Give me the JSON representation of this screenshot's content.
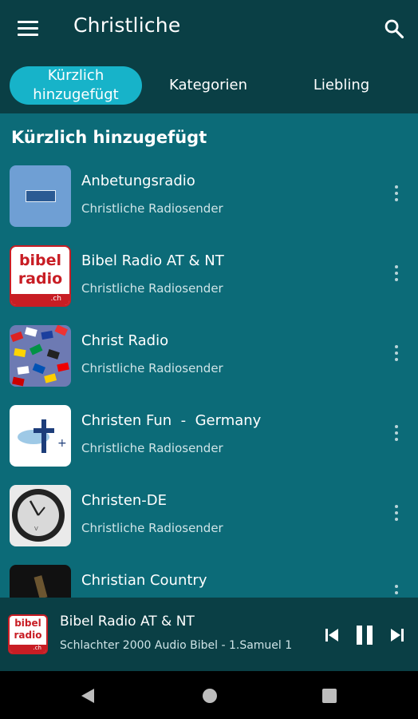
{
  "appbar": {
    "title": "Christliche",
    "menu_icon": "menu-icon",
    "search_icon": "search-icon"
  },
  "tabs": [
    {
      "label_line1": "Kürzlich",
      "label_line2": "hinzugefügt",
      "active": true
    },
    {
      "label": "Kategorien",
      "active": false
    },
    {
      "label": "Liebling",
      "active": false
    }
  ],
  "section_title": "Kürzlich hinzugefügt",
  "stations": [
    {
      "name": "Anbetungsradio",
      "category": "Christliche Radiosender"
    },
    {
      "name": "Bibel Radio AT & NT",
      "category": "Christliche Radiosender"
    },
    {
      "name": "Christ Radio",
      "category": "Christliche Radiosender"
    },
    {
      "name": "Christen Fun  -  Germany",
      "category": "Christliche Radiosender"
    },
    {
      "name": "Christen-DE",
      "category": "Christliche Radiosender"
    },
    {
      "name": "Christian Country",
      "category": ""
    }
  ],
  "logo_text": {
    "bibel": "bibel",
    "radio": "radio",
    "ch": ".ch"
  },
  "player": {
    "title": "Bibel Radio AT & NT",
    "subtitle": "Schlachter 2000 Audio Bibel - 1.Samuel 1",
    "state": "playing"
  },
  "colors": {
    "background": "#0c6b78",
    "bar": "#0a3f45",
    "accent": "#17b3c9"
  }
}
